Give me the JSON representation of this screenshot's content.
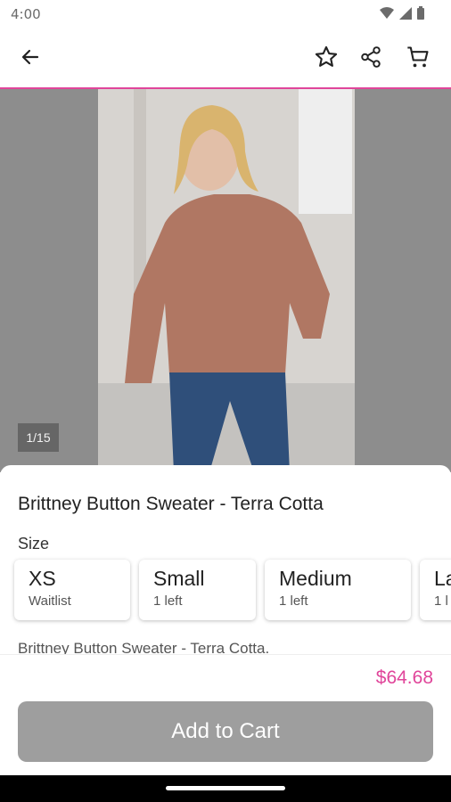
{
  "status_bar": {
    "time": "4:00"
  },
  "app_bar": {
    "back_icon": "arrow-left-icon",
    "favorite_icon": "star-outline-icon",
    "share_icon": "share-icon",
    "cart_icon": "cart-icon",
    "accent_color": "#e0459a"
  },
  "gallery": {
    "counter": "1/15"
  },
  "product": {
    "title": "Brittney Button Sweater - Terra Cotta",
    "size_label": "Size",
    "sizes": [
      {
        "name": "XS",
        "status": "Waitlist"
      },
      {
        "name": "Small",
        "status": "1 left"
      },
      {
        "name": "Medium",
        "status": "1 left"
      },
      {
        "name": "La",
        "status": "1 l"
      }
    ],
    "description": "Brittney Button Sweater - Terra Cotta."
  },
  "footer": {
    "price": "$64.68",
    "add_to_cart_label": "Add to Cart",
    "price_color": "#e0459a",
    "button_color": "#9e9e9e"
  }
}
